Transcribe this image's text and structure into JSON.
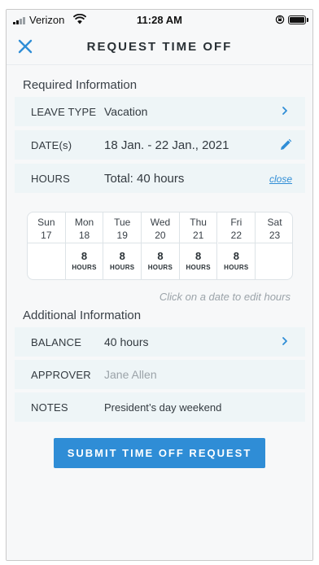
{
  "status_bar": {
    "carrier": "Verizon",
    "time": "11:28 AM",
    "icons": [
      "signal-icon",
      "wifi-icon",
      "orientation-lock-icon",
      "battery-icon"
    ]
  },
  "header": {
    "title": "REQUEST TIME OFF",
    "close_icon": "close-icon"
  },
  "required": {
    "section_title": "Required Information",
    "leave_type": {
      "label": "LEAVE TYPE",
      "value": "Vacation"
    },
    "dates": {
      "label": "DATE(s)",
      "value": "18 Jan. - 22 Jan., 2021"
    },
    "hours": {
      "label": "HOURS",
      "value": "Total: 40 hours",
      "link": "close"
    }
  },
  "calendar": {
    "days": [
      {
        "dow": "Sun",
        "date": "17",
        "hours": "",
        "unit": ""
      },
      {
        "dow": "Mon",
        "date": "18",
        "hours": "8",
        "unit": "HOURS"
      },
      {
        "dow": "Tue",
        "date": "19",
        "hours": "8",
        "unit": "HOURS"
      },
      {
        "dow": "Wed",
        "date": "20",
        "hours": "8",
        "unit": "HOURS"
      },
      {
        "dow": "Thu",
        "date": "21",
        "hours": "8",
        "unit": "HOURS"
      },
      {
        "dow": "Fri",
        "date": "22",
        "hours": "8",
        "unit": "HOURS"
      },
      {
        "dow": "Sat",
        "date": "23",
        "hours": "",
        "unit": ""
      }
    ],
    "hint": "Click on a date to edit hours"
  },
  "additional": {
    "section_title": "Additional Information",
    "balance": {
      "label": "BALANCE",
      "value": "40 hours"
    },
    "approver": {
      "label": "APPROVER",
      "value": "Jane Allen"
    },
    "notes": {
      "label": "NOTES",
      "value": "President’s day weekend"
    }
  },
  "submit_label": "SUBMIT TIME OFF REQUEST",
  "colors": {
    "accent": "#2f8dd6",
    "row_background": "#eef5f7",
    "page_background": "#f7f8f9"
  }
}
